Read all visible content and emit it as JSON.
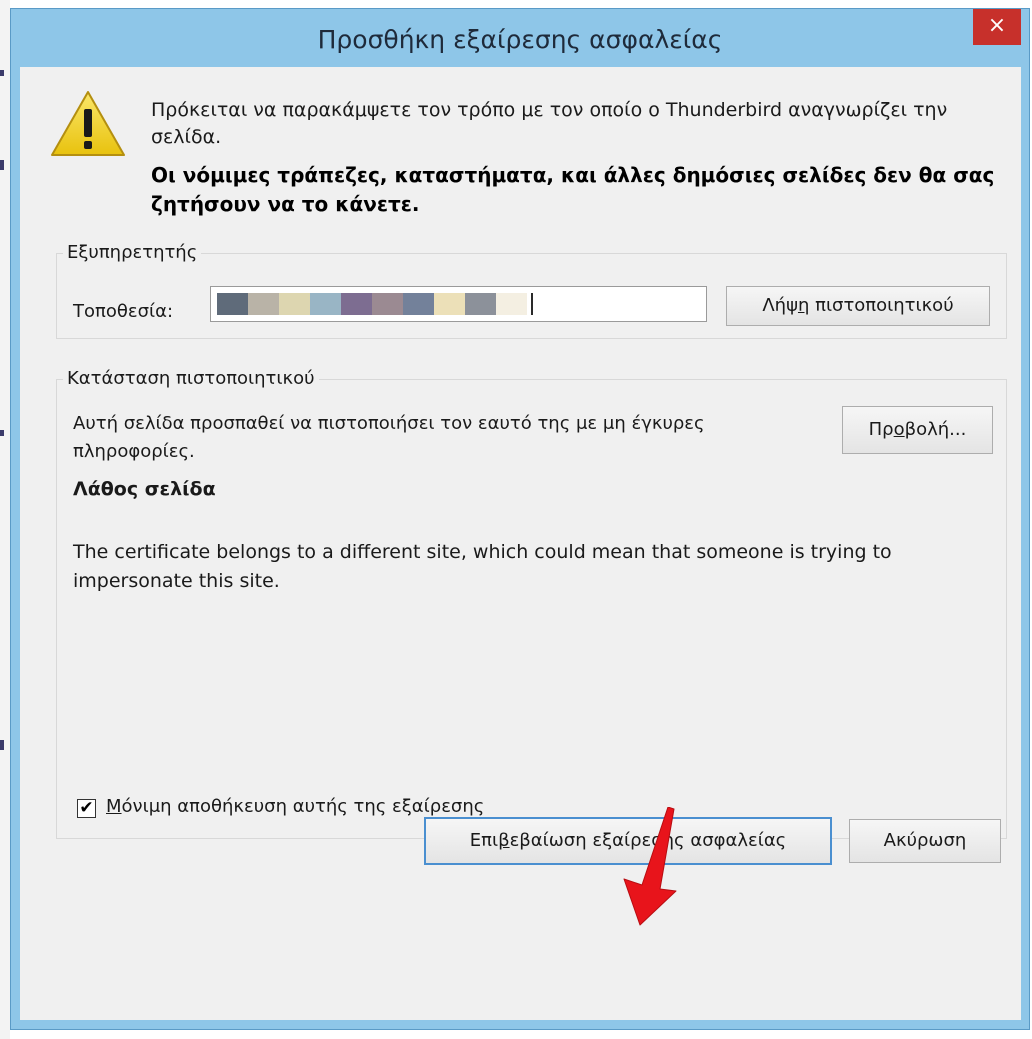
{
  "window": {
    "title": "Προσθήκη εξαίρεσης ασφαλείας",
    "close_label": "×"
  },
  "warning": {
    "icon": "warning-icon",
    "message": "Πρόκειται να παρακάμψετε τον τρόπο με τον οποίο ο Thunderbird αναγνωρίζει την σελίδα.",
    "emphasis": "Οι νόμιμες τράπεζες, καταστήματα, και άλλες δημόσιες σελίδες δεν θα σας ζητήσουν να το κάνετε."
  },
  "server": {
    "legend": "Εξυπηρετητής",
    "location_label": "Τοποθεσία:",
    "location_value_colors": [
      "#5f6b7a",
      "#b9b3a7",
      "#ddd6b0",
      "#99b5c5",
      "#7d6d91",
      "#9b8a92",
      "#73819a",
      "#ece0b8",
      "#8c919a",
      "#f4efe2"
    ],
    "get_certificate_button": {
      "before": "Λήψ",
      "accel": "η",
      "after": " πιστοποιητικού"
    }
  },
  "status": {
    "legend": "Κατάσταση πιστοποιητικού",
    "text": "Αυτή σελίδα προσπαθεί να πιστοποιήσει τον εαυτό της με μη έγκυρες πληροφορίες.",
    "view_button": {
      "before": "Πρ",
      "accel": "ο",
      "after": "βολή..."
    },
    "heading": "Λάθος σελίδα",
    "detail": "The certificate belongs to a different site, which could mean that someone is trying to impersonate this site."
  },
  "permanent": {
    "checked": true,
    "check_glyph": "✔",
    "label": {
      "before": "",
      "accel": "Μ",
      "after": "όνιμη αποθήκευση αυτής της εξαίρεσης"
    }
  },
  "buttons": {
    "confirm": {
      "before": "Επι",
      "accel": "β",
      "after": "εβαίωση εξαίρεσης ασφαλείας"
    },
    "cancel": "Ακύρωση"
  },
  "colors": {
    "titlebar": "#8ec6e8",
    "close": "#c7302b",
    "arrow": "#e8141b",
    "warning_fill": "#f2d21b"
  }
}
